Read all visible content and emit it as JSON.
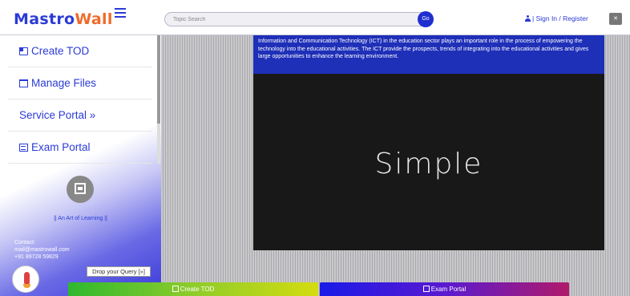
{
  "header": {
    "logo_part1": "Mastro",
    "logo_part2": "Wall",
    "search_placeholder": "Topic Search",
    "go_label": "Go",
    "signin_label": "| Sign In / Register",
    "mute_icon": "speaker-mute-icon"
  },
  "sidebar": {
    "items": [
      {
        "label": "Create TOD",
        "icon": "create-icon"
      },
      {
        "label": "Manage Files",
        "icon": "folder-icon"
      },
      {
        "label": "Service Portal »",
        "icon": ""
      },
      {
        "label": "Exam Portal",
        "icon": "exam-icon"
      }
    ],
    "tagline": "|| An Art of Learning ||",
    "contact_title": "Contact:",
    "email": "mail@mastrowall.com",
    "phone": "+91 89728 59829",
    "drop_query": "Drop your Query [»]"
  },
  "content": {
    "info_text": "Information and Communication Technology (ICT) in the education sector plays an important role in the process of empowering the technology into the educational activities. The ICT provide the prospects, trends of integrating into the educational activities and gives large opportunities to enhance the learning environment.",
    "video_text": "Simple"
  },
  "bottom_bar": {
    "create_label": "Create TOD",
    "exam_label": "Exam Portal"
  },
  "colors": {
    "brand_blue": "#2b3bd6",
    "brand_orange": "#f06a2a",
    "info_bg": "#1e2fb8"
  }
}
